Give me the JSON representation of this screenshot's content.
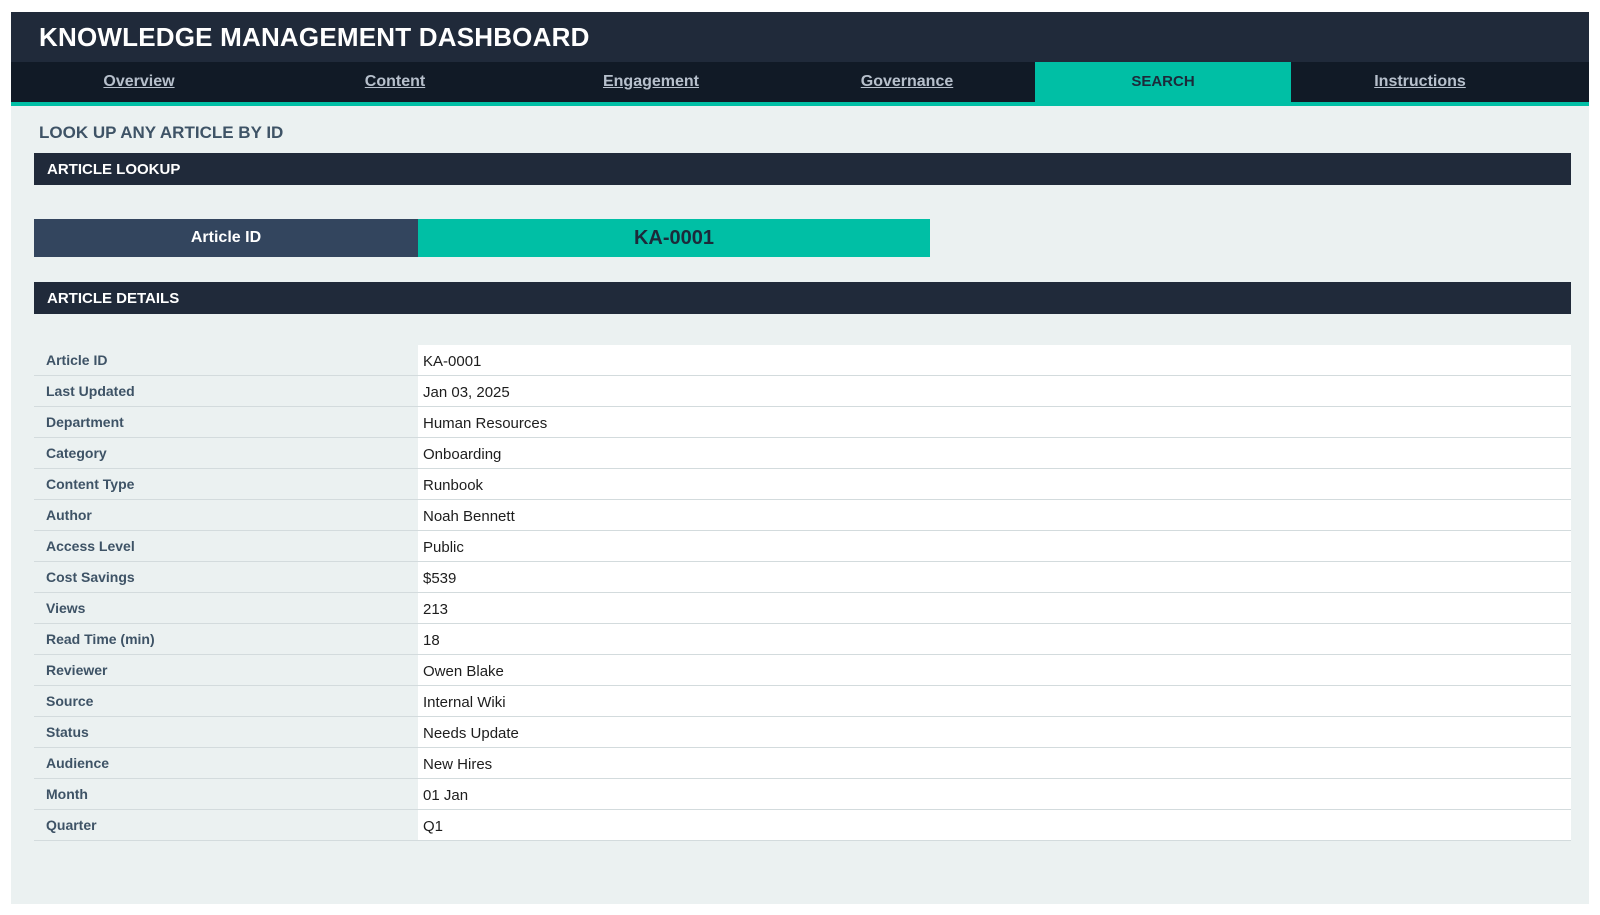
{
  "app": {
    "title": "KNOWLEDGE MANAGEMENT DASHBOARD"
  },
  "nav": {
    "tabs": [
      {
        "label": "Overview",
        "active": false
      },
      {
        "label": "Content",
        "active": false
      },
      {
        "label": "Engagement",
        "active": false
      },
      {
        "label": "Governance",
        "active": false
      },
      {
        "label": "SEARCH",
        "active": true
      },
      {
        "label": "Instructions",
        "active": false
      }
    ]
  },
  "page": {
    "subtitle": "LOOK UP ANY ARTICLE BY ID"
  },
  "lookup": {
    "section_title": "ARTICLE LOOKUP",
    "label": "Article ID",
    "value": "KA-0001"
  },
  "details": {
    "section_title": "ARTICLE DETAILS",
    "rows": [
      {
        "key": "Article ID",
        "value": "KA-0001"
      },
      {
        "key": "Last Updated",
        "value": "Jan 03, 2025"
      },
      {
        "key": "Department",
        "value": "Human Resources"
      },
      {
        "key": "Category",
        "value": "Onboarding"
      },
      {
        "key": "Content Type",
        "value": "Runbook"
      },
      {
        "key": "Author",
        "value": "Noah Bennett"
      },
      {
        "key": "Access Level",
        "value": "Public"
      },
      {
        "key": "Cost Savings",
        "value": "$539"
      },
      {
        "key": "Views",
        "value": "213"
      },
      {
        "key": "Read Time (min)",
        "value": "18"
      },
      {
        "key": "Reviewer",
        "value": "Owen Blake"
      },
      {
        "key": "Source",
        "value": "Internal Wiki"
      },
      {
        "key": "Status",
        "value": "Needs Update"
      },
      {
        "key": "Audience",
        "value": "New Hires"
      },
      {
        "key": "Month",
        "value": "01 Jan"
      },
      {
        "key": "Quarter",
        "value": "Q1"
      }
    ]
  },
  "colors": {
    "header_dark": "#202a3a",
    "nav_dark": "#111a26",
    "accent": "#00bfa5",
    "label_block": "#33455e",
    "sheet_bg": "#ebf1f1"
  }
}
